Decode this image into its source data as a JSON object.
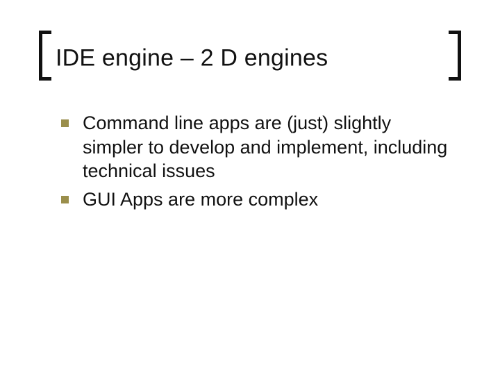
{
  "slide": {
    "title": "IDE engine – 2 D engines",
    "bullets": [
      "Command line apps are (just) slightly simpler to develop and implement, including technical issues",
      "GUI Apps are more complex"
    ]
  },
  "colors": {
    "bullet": "#9a8e4b",
    "bracket": "#111111"
  }
}
